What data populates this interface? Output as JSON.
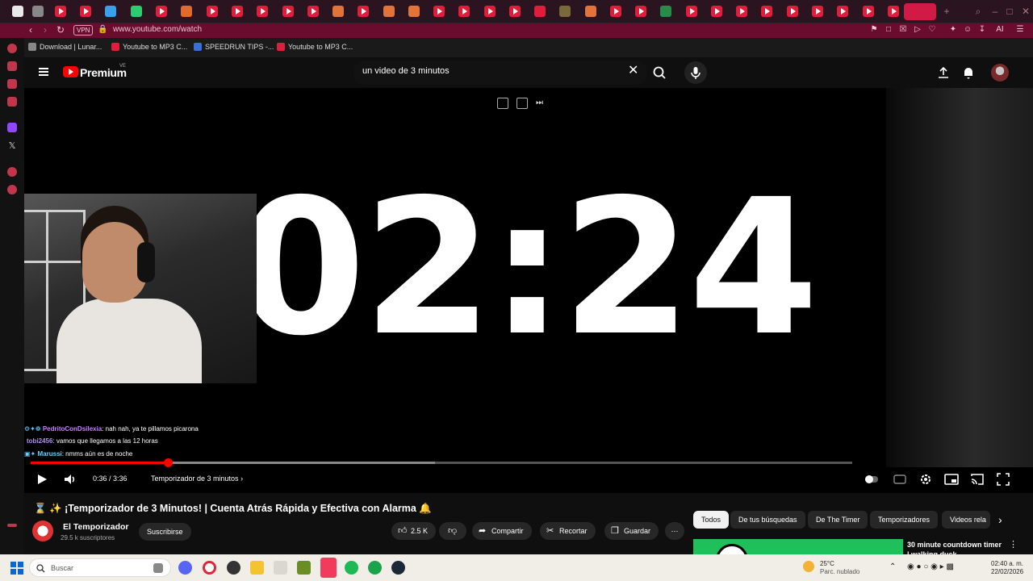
{
  "browser": {
    "url": "www.youtube.com/watch",
    "vpn_label": "VPN",
    "ai_label": "AI",
    "bookmarks": [
      {
        "label": "Download | Lunar...",
        "color": "#888888"
      },
      {
        "label": "Youtube to MP3 C...",
        "color": "#e01e3c"
      },
      {
        "label": "SPEEDRUN TIPS -...",
        "color": "#3b6fd8"
      },
      {
        "label": "Youtube to MP3 C...",
        "color": "#e01e3c"
      }
    ]
  },
  "youtube": {
    "brand": "Premium",
    "country_code": "VE",
    "search": {
      "value": "un video de 3 minutos"
    }
  },
  "player": {
    "timer_display": "02:24",
    "current_time": "0:36",
    "duration": "3:36",
    "time_separator": " / ",
    "progress_fraction": 0.1667,
    "chapter": "Temporizador de 3 minutos",
    "chat": [
      {
        "badges": "⚙✦❁",
        "user": "PedritoConDsilexia",
        "user_color": "#c77dff",
        "message": ": nah nah, ya te pillamos picarona"
      },
      {
        "badges": "",
        "user": "tobi2456",
        "user_color": "#b58cff",
        "message": ": vamos que llegamos a las 12 horas"
      },
      {
        "badges": "▣✦",
        "user": "Marussi",
        "user_color": "#5fd3ff",
        "message": ": nmms aún es de noche"
      }
    ]
  },
  "video": {
    "title": "⌛ ✨ ¡Temporizador de 3 Minutos! | Cuenta Atrás Rápida y Efectiva con Alarma 🔔",
    "channel": "El Temporizador",
    "subscribers": "29.5 k suscriptores",
    "subscribe_label": "Suscribirse",
    "likes": "2.5 K",
    "share_label": "Compartir",
    "clip_label": "Recortar",
    "save_label": "Guardar"
  },
  "related": {
    "chips": [
      "Todos",
      "De tus búsquedas",
      "De The Timer",
      "Temporizadores",
      "Videos rela"
    ],
    "next_title": "30 minute countdown timer | walking duck"
  },
  "taskbar": {
    "search_placeholder": "Buscar",
    "weather_temp": "25°C",
    "weather_desc": "Parc. nublado",
    "time": "02:40 a. m.",
    "date": "22/02/2026"
  }
}
